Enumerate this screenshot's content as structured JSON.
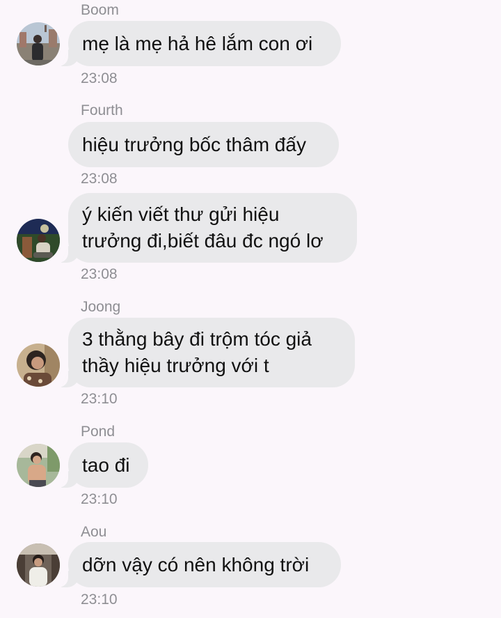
{
  "messages": [
    {
      "sender": "Boom",
      "lines": [
        "mẹ là mẹ hả hê lắm con ơi"
      ],
      "time": "23:08",
      "avatar": "person-city-avatar"
    },
    {
      "sender": "Fourth",
      "lines": [
        "hiệu trưởng bốc thâm đấy"
      ],
      "time": "23:08",
      "avatar": ""
    },
    {
      "sender": "",
      "lines": [
        "ý kiến viết thư gửi hiệu",
        "trưởng đi,biết đâu đc ngó lơ"
      ],
      "time": "23:08",
      "avatar": "person-night-avatar"
    },
    {
      "sender": "Joong",
      "lines": [
        "3 thằng bây đi trộm tóc giả",
        "thầy hiệu trưởng với t"
      ],
      "time": "23:10",
      "avatar": "person-portrait-avatar"
    },
    {
      "sender": "Pond",
      "lines": [
        "tao đi"
      ],
      "time": "23:10",
      "avatar": "person-outdoor-avatar"
    },
    {
      "sender": "Aou",
      "lines": [
        "dỡn vậy có nên không trời"
      ],
      "time": "23:10",
      "avatar": "person-street-avatar"
    }
  ],
  "colors": {
    "background": "#fbf6fb",
    "bubble": "#e9e9eb",
    "meta_text": "#8e8e93",
    "message_text": "#111111"
  }
}
